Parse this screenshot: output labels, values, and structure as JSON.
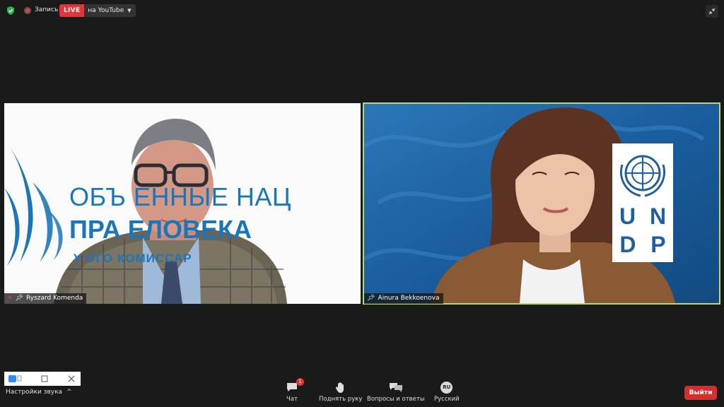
{
  "topbar": {
    "record_label": "Запись",
    "live_badge": "LIVE",
    "live_target": "на YouTube"
  },
  "participants": [
    {
      "name": "Ryszard Komenda",
      "muted": true,
      "pinned": true
    },
    {
      "name": "Ainura Bekkoenova",
      "muted": false,
      "pinned": true,
      "active_speaker": true
    }
  ],
  "left_video": {
    "backdrop_line1": "ОБЪ   ЕННЫЕ НАЦ",
    "backdrop_line2": "ПРА      ЕЛОВЕКА",
    "backdrop_line3": "У             ОГО КОМИССАР"
  },
  "right_video": {
    "logo_letters": [
      "U",
      "N",
      "D",
      "P"
    ]
  },
  "mini_window": {},
  "sound_settings": {
    "label": "Настройки звука",
    "chevron": "^"
  },
  "toolbar": {
    "chat": {
      "label": "Чат",
      "badge": "1"
    },
    "raise_hand": {
      "label": "Поднять руку"
    },
    "qa": {
      "label": "Вопросы и ответы"
    },
    "language": {
      "label": "Русский",
      "code": "RU"
    },
    "exit_label": "Выйти"
  },
  "colors": {
    "background": "#1a1a1a",
    "live_red": "#e0363b",
    "active_speaker_border": "#b7d87a",
    "exit_red": "#d32f2f",
    "un_blue": "#1b75bb"
  }
}
